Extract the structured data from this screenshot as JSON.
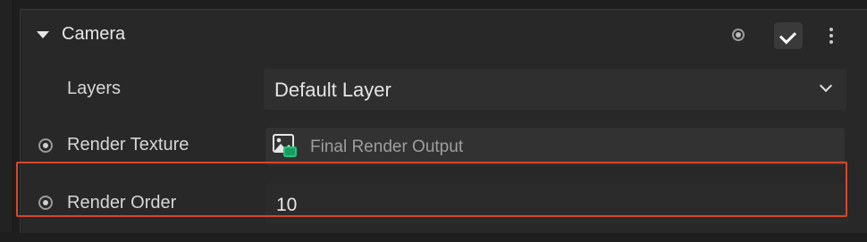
{
  "component": {
    "title": "Camera",
    "icons": {
      "collapse": "caret-down-icon",
      "settings_radio": "radio-dot-icon",
      "enabled": "checkmark-icon",
      "more": "vertical-ellipsis-icon"
    },
    "enabled": true
  },
  "properties": {
    "layers": {
      "label": "Layers",
      "value": "Default Layer",
      "control": "dropdown"
    },
    "render_texture": {
      "label": "Render Texture",
      "value": "Final Render Output",
      "icon": "render-texture-image-icon"
    },
    "render_order": {
      "label": "Render Order",
      "value": "10"
    }
  },
  "colors": {
    "highlight": "#d9472b",
    "panel": "#282828",
    "field": "#2f2f2f",
    "texture_icon_accent": "#22c37a"
  }
}
